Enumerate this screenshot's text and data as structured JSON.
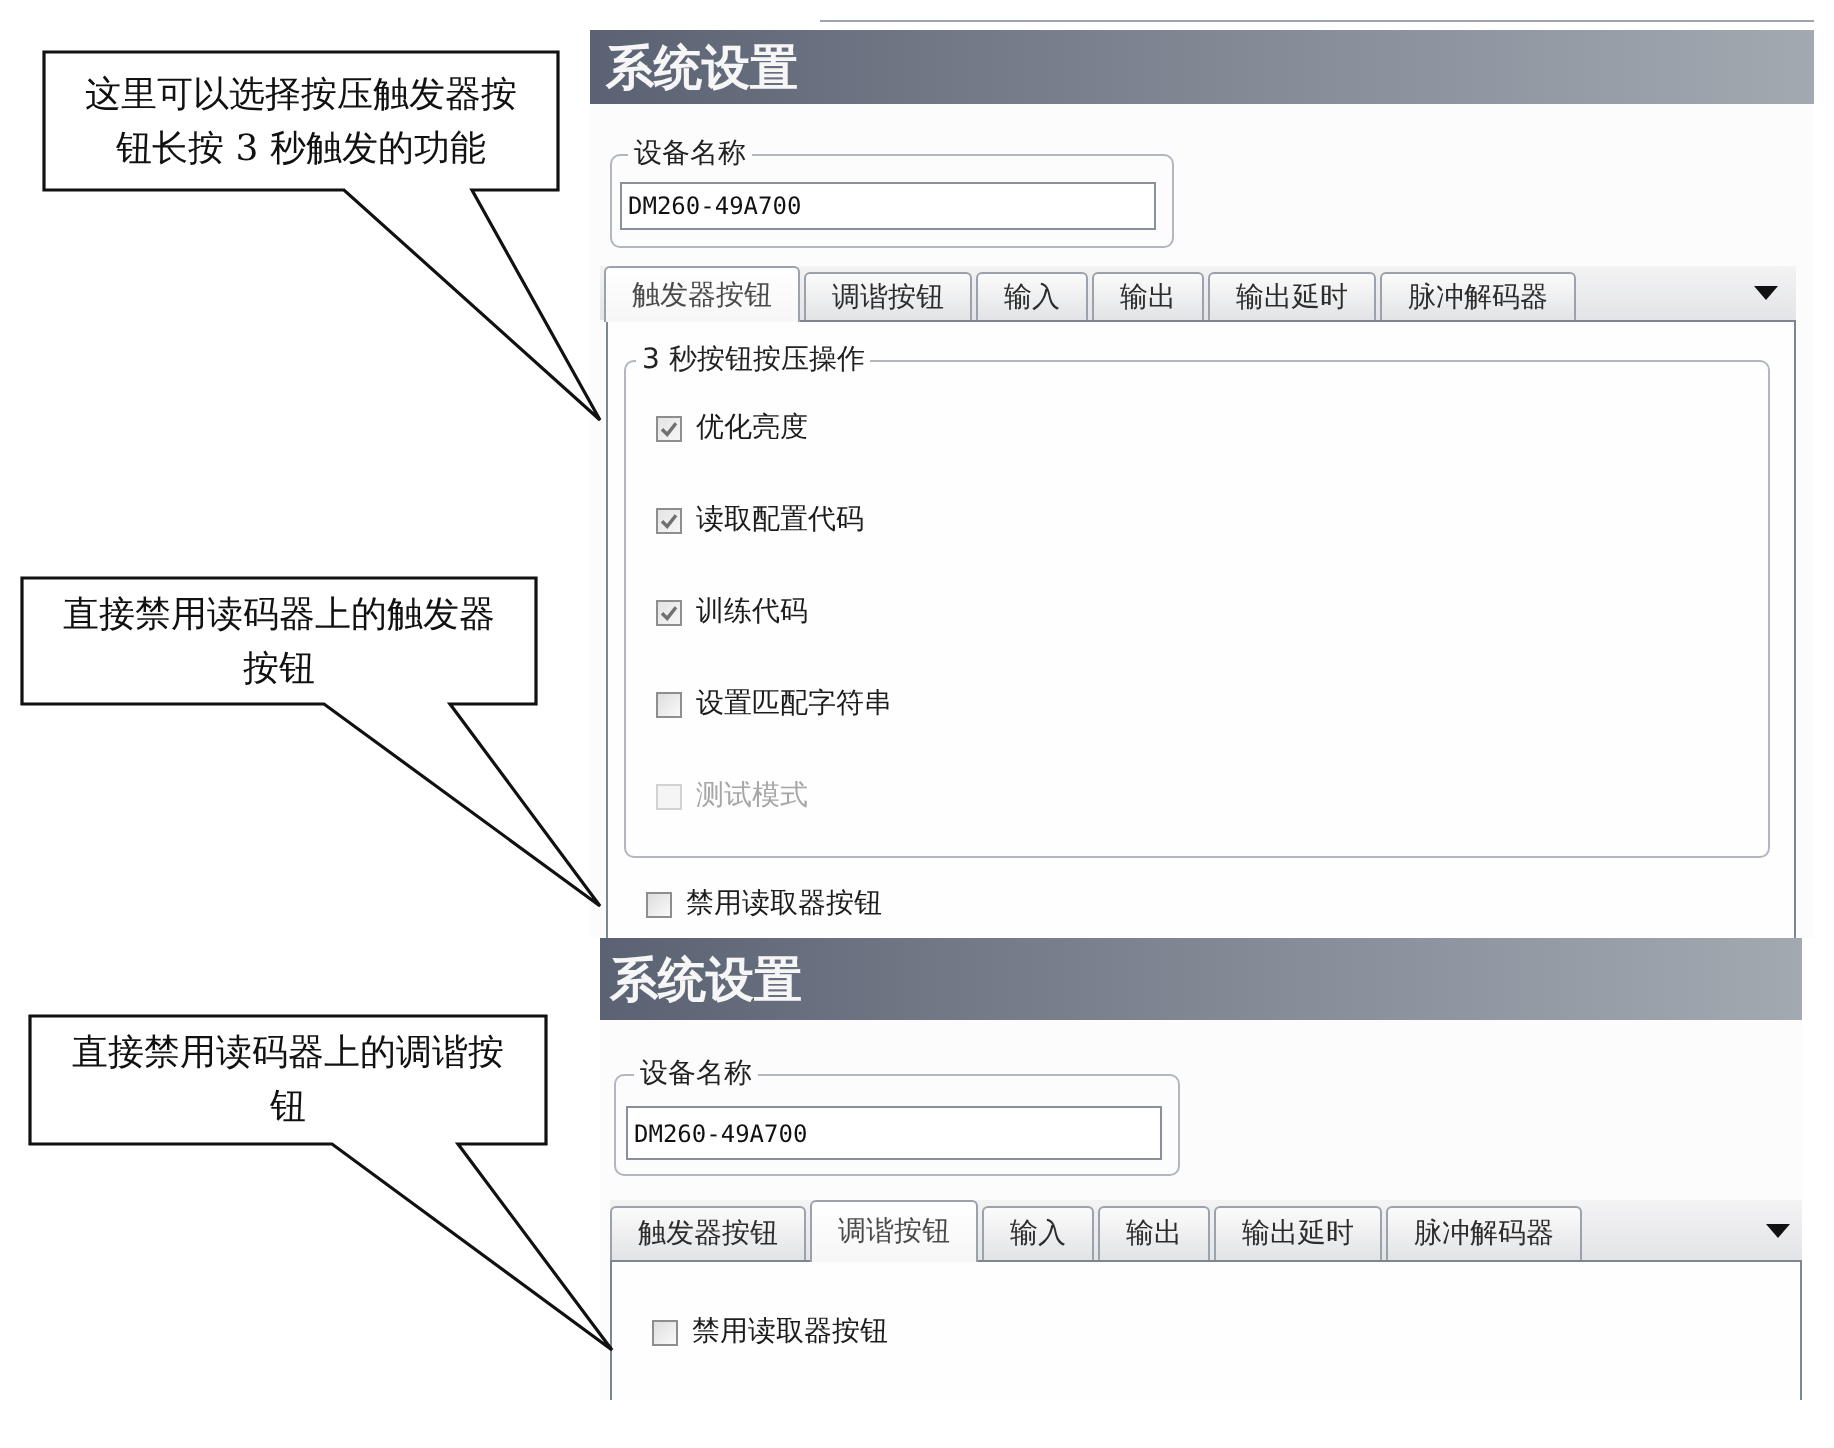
{
  "annotations": [
    {
      "text": "这里可以选择按压触发器按钮长按 3 秒触发的功能"
    },
    {
      "text": "直接禁用读码器上的触发器按钮"
    },
    {
      "text": "直接禁用读码器上的调谐按钮"
    }
  ],
  "panels": [
    {
      "title": "系统设置",
      "device_name": {
        "label": "设备名称",
        "value": "DM260-49A700"
      },
      "tabs": [
        {
          "label": "触发器按钮",
          "selected": true
        },
        {
          "label": "调谐按钮",
          "selected": false
        },
        {
          "label": "输入",
          "selected": false
        },
        {
          "label": "输出",
          "selected": false
        },
        {
          "label": "输出延时",
          "selected": false
        },
        {
          "label": "脉冲解码器",
          "selected": false
        }
      ],
      "group": {
        "label": "3 秒按钮按压操作",
        "options": [
          {
            "label": "优化亮度",
            "checked": true,
            "disabled": false
          },
          {
            "label": "读取配置代码",
            "checked": true,
            "disabled": false
          },
          {
            "label": "训练代码",
            "checked": true,
            "disabled": false
          },
          {
            "label": "设置匹配字符串",
            "checked": false,
            "disabled": false
          },
          {
            "label": "测试模式",
            "checked": false,
            "disabled": true
          }
        ]
      },
      "options": [
        {
          "label": "禁用读取器按钮",
          "checked": false,
          "disabled": false
        }
      ]
    },
    {
      "title": "系统设置",
      "device_name": {
        "label": "设备名称",
        "value": "DM260-49A700"
      },
      "tabs": [
        {
          "label": "触发器按钮",
          "selected": false
        },
        {
          "label": "调谐按钮",
          "selected": true
        },
        {
          "label": "输入",
          "selected": false
        },
        {
          "label": "输出",
          "selected": false
        },
        {
          "label": "输出延时",
          "selected": false
        },
        {
          "label": "脉冲解码器",
          "selected": false
        }
      ],
      "options": [
        {
          "label": "禁用读取器按钮",
          "checked": false,
          "disabled": false
        }
      ]
    }
  ]
}
